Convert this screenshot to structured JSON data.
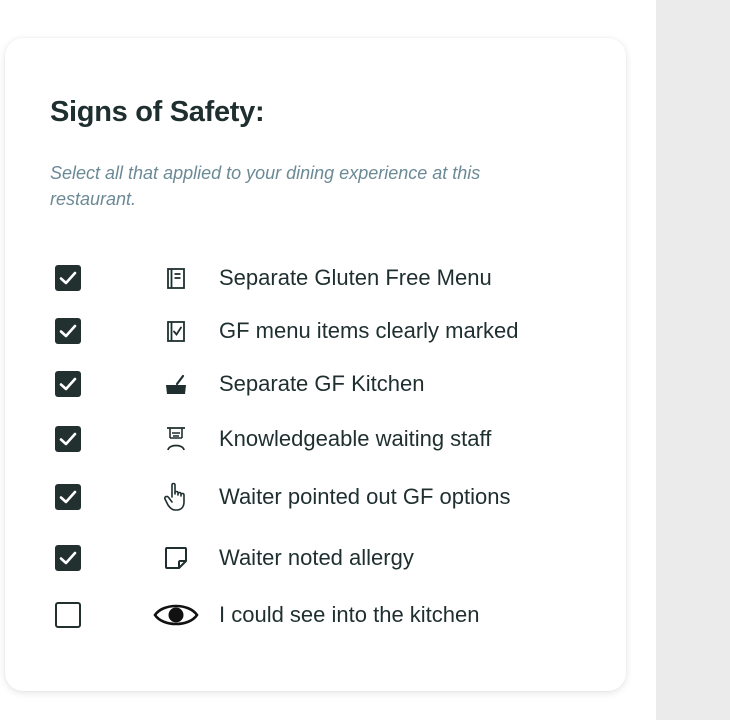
{
  "section": {
    "title": "Signs of Safety:",
    "subtitle": "Select all that applied to your dining experience at this restaurant."
  },
  "options": [
    {
      "label": "Separate Gluten Free Menu",
      "checked": true,
      "icon": "menu-icon"
    },
    {
      "label": "GF menu items clearly marked",
      "checked": true,
      "icon": "checklist-icon"
    },
    {
      "label": "Separate GF Kitchen",
      "checked": true,
      "icon": "cooking-pot-icon"
    },
    {
      "label": "Knowledgeable waiting staff",
      "checked": true,
      "icon": "waiter-icon"
    },
    {
      "label": "Waiter pointed out GF options",
      "checked": true,
      "icon": "pointing-hand-icon"
    },
    {
      "label": "Waiter noted allergy",
      "checked": true,
      "icon": "note-icon"
    },
    {
      "label": "I could see into the kitchen",
      "checked": false,
      "icon": "eye-icon"
    }
  ],
  "colors": {
    "text": "#1f2f2f",
    "subtitle": "#6b8a95",
    "checkbox": "#233030",
    "side_panel": "#ebebeb"
  }
}
